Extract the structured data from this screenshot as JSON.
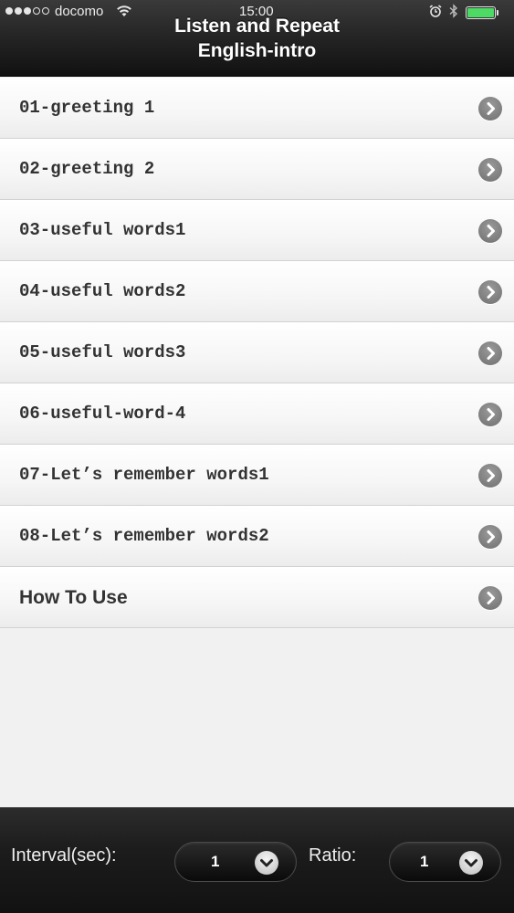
{
  "status_bar": {
    "carrier": "docomo",
    "time": "15:00",
    "signal_bars": 3,
    "signal_total": 5,
    "battery_level": 1.0
  },
  "header": {
    "title_line1": "Listen and Repeat",
    "title_line2": "English-intro"
  },
  "list": {
    "items": [
      {
        "label": "01-greeting 1"
      },
      {
        "label": "02-greeting 2"
      },
      {
        "label": "03-useful words1"
      },
      {
        "label": "04-useful words2"
      },
      {
        "label": "05-useful words3"
      },
      {
        "label": "06-useful-word-4"
      },
      {
        "label": "07-Let’s remember words1"
      },
      {
        "label": "08-Let’s remember words2"
      },
      {
        "label": "How To Use"
      }
    ]
  },
  "footer": {
    "interval_label": "Interval(sec):",
    "interval_value": "1",
    "ratio_label": "Ratio:",
    "ratio_value": "1"
  },
  "colors": {
    "battery": "#4cd964",
    "header_bg": "#1e1e1e",
    "list_bg": "#f1f1f1",
    "row_text": "#333333",
    "chevron": "#7d7d7d"
  }
}
